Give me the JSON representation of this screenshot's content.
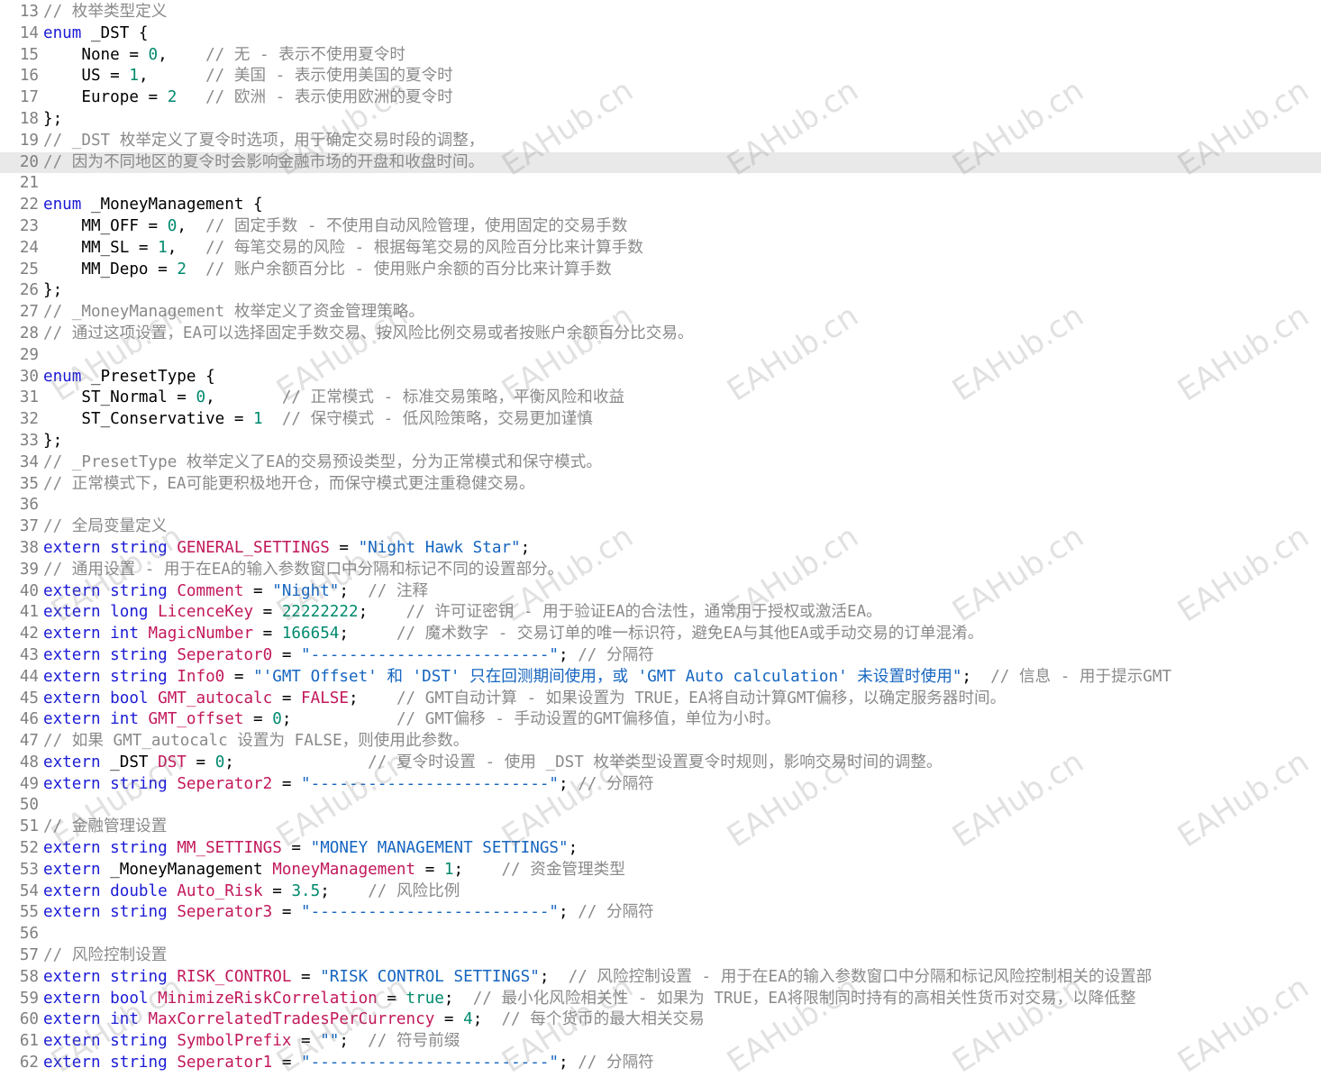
{
  "editor": {
    "lines": [
      {
        "n": "13",
        "t": [
          [
            "c",
            "// 枚举类型定义"
          ]
        ]
      },
      {
        "n": "14",
        "t": [
          [
            "k",
            "enum"
          ],
          [
            "p",
            " _DST {"
          ]
        ]
      },
      {
        "n": "15",
        "t": [
          [
            "i",
            "    None"
          ],
          [
            "p",
            " = "
          ],
          [
            "n",
            "0"
          ],
          [
            "p",
            ",    "
          ],
          [
            "c",
            "// 无 - 表示不使用夏令时"
          ]
        ]
      },
      {
        "n": "16",
        "t": [
          [
            "i",
            "    US"
          ],
          [
            "p",
            " = "
          ],
          [
            "n",
            "1"
          ],
          [
            "p",
            ",      "
          ],
          [
            "c",
            "// 美国 - 表示使用美国的夏令时"
          ]
        ]
      },
      {
        "n": "17",
        "t": [
          [
            "i",
            "    Europe"
          ],
          [
            "p",
            " = "
          ],
          [
            "n",
            "2"
          ],
          [
            "p",
            "   "
          ],
          [
            "c",
            "// 欧洲 - 表示使用欧洲的夏令时"
          ]
        ]
      },
      {
        "n": "18",
        "t": [
          [
            "p",
            "};"
          ]
        ]
      },
      {
        "n": "19",
        "t": [
          [
            "c",
            "// _DST 枚举定义了夏令时选项，用于确定交易时段的调整，"
          ]
        ]
      },
      {
        "n": "20",
        "t": [
          [
            "c",
            "// 因为不同地区的夏令时会影响金融市场的开盘和收盘时间。"
          ]
        ],
        "current": true
      },
      {
        "n": "21",
        "t": []
      },
      {
        "n": "22",
        "t": [
          [
            "k",
            "enum"
          ],
          [
            "p",
            " _MoneyManagement {"
          ]
        ]
      },
      {
        "n": "23",
        "t": [
          [
            "i",
            "    MM_OFF"
          ],
          [
            "p",
            " = "
          ],
          [
            "n",
            "0"
          ],
          [
            "p",
            ",  "
          ],
          [
            "c",
            "// 固定手数 - 不使用自动风险管理，使用固定的交易手数"
          ]
        ]
      },
      {
        "n": "24",
        "t": [
          [
            "i",
            "    MM_SL"
          ],
          [
            "p",
            " = "
          ],
          [
            "n",
            "1"
          ],
          [
            "p",
            ",   "
          ],
          [
            "c",
            "// 每笔交易的风险 - 根据每笔交易的风险百分比来计算手数"
          ]
        ]
      },
      {
        "n": "25",
        "t": [
          [
            "i",
            "    MM_Depo"
          ],
          [
            "p",
            " = "
          ],
          [
            "n",
            "2"
          ],
          [
            "p",
            "  "
          ],
          [
            "c",
            "// 账户余额百分比 - 使用账户余额的百分比来计算手数"
          ]
        ]
      },
      {
        "n": "26",
        "t": [
          [
            "p",
            "};"
          ]
        ]
      },
      {
        "n": "27",
        "t": [
          [
            "c",
            "// _MoneyManagement 枚举定义了资金管理策略。"
          ]
        ]
      },
      {
        "n": "28",
        "t": [
          [
            "c",
            "// 通过这项设置，EA可以选择固定手数交易、按风险比例交易或者按账户余额百分比交易。"
          ]
        ]
      },
      {
        "n": "29",
        "t": []
      },
      {
        "n": "30",
        "t": [
          [
            "k",
            "enum"
          ],
          [
            "p",
            " _PresetType {"
          ]
        ]
      },
      {
        "n": "31",
        "t": [
          [
            "i",
            "    ST_Normal"
          ],
          [
            "p",
            " = "
          ],
          [
            "n",
            "0"
          ],
          [
            "p",
            ",       "
          ],
          [
            "c",
            "// 正常模式 - 标准交易策略，平衡风险和收益"
          ]
        ]
      },
      {
        "n": "32",
        "t": [
          [
            "i",
            "    ST_Conservative"
          ],
          [
            "p",
            " = "
          ],
          [
            "n",
            "1"
          ],
          [
            "p",
            "  "
          ],
          [
            "c",
            "// 保守模式 - 低风险策略，交易更加谨慎"
          ]
        ]
      },
      {
        "n": "33",
        "t": [
          [
            "p",
            "};"
          ]
        ]
      },
      {
        "n": "34",
        "t": [
          [
            "c",
            "// _PresetType 枚举定义了EA的交易预设类型，分为正常模式和保守模式。"
          ]
        ]
      },
      {
        "n": "35",
        "t": [
          [
            "c",
            "// 正常模式下，EA可能更积极地开仓，而保守模式更注重稳健交易。"
          ]
        ]
      },
      {
        "n": "36",
        "t": []
      },
      {
        "n": "37",
        "t": [
          [
            "c",
            "// 全局变量定义"
          ]
        ]
      },
      {
        "n": "38",
        "t": [
          [
            "k",
            "extern"
          ],
          [
            "p",
            " "
          ],
          [
            "k",
            "string"
          ],
          [
            "p",
            " "
          ],
          [
            "v",
            "GENERAL_SETTINGS"
          ],
          [
            "p",
            " = "
          ],
          [
            "s",
            "\"Night Hawk Star\""
          ],
          [
            "p",
            ";"
          ]
        ]
      },
      {
        "n": "39",
        "t": [
          [
            "c",
            "// 通用设置 - 用于在EA的输入参数窗口中分隔和标记不同的设置部分。"
          ]
        ]
      },
      {
        "n": "40",
        "t": [
          [
            "k",
            "extern"
          ],
          [
            "p",
            " "
          ],
          [
            "k",
            "string"
          ],
          [
            "p",
            " "
          ],
          [
            "v",
            "Comment"
          ],
          [
            "p",
            " = "
          ],
          [
            "s",
            "\"Night\""
          ],
          [
            "p",
            ";  "
          ],
          [
            "c",
            "// 注释"
          ]
        ]
      },
      {
        "n": "41",
        "t": [
          [
            "k",
            "extern"
          ],
          [
            "p",
            " "
          ],
          [
            "k",
            "long"
          ],
          [
            "p",
            " "
          ],
          [
            "v",
            "LicenceKey"
          ],
          [
            "p",
            " = "
          ],
          [
            "n",
            "22222222"
          ],
          [
            "p",
            ";    "
          ],
          [
            "c",
            "// 许可证密钥 - 用于验证EA的合法性，通常用于授权或激活EA。"
          ]
        ]
      },
      {
        "n": "42",
        "t": [
          [
            "k",
            "extern"
          ],
          [
            "p",
            " "
          ],
          [
            "k",
            "int"
          ],
          [
            "p",
            " "
          ],
          [
            "v",
            "MagicNumber"
          ],
          [
            "p",
            " = "
          ],
          [
            "n",
            "166654"
          ],
          [
            "p",
            ";     "
          ],
          [
            "c",
            "// 魔术数字 - 交易订单的唯一标识符，避免EA与其他EA或手动交易的订单混淆。"
          ]
        ]
      },
      {
        "n": "43",
        "t": [
          [
            "k",
            "extern"
          ],
          [
            "p",
            " "
          ],
          [
            "k",
            "string"
          ],
          [
            "p",
            " "
          ],
          [
            "v",
            "Seperator0"
          ],
          [
            "p",
            " = "
          ],
          [
            "s",
            "\"-------------------------\""
          ],
          [
            "p",
            "; "
          ],
          [
            "c",
            "// 分隔符"
          ]
        ]
      },
      {
        "n": "44",
        "t": [
          [
            "k",
            "extern"
          ],
          [
            "p",
            " "
          ],
          [
            "k",
            "string"
          ],
          [
            "p",
            " "
          ],
          [
            "v",
            "Info0"
          ],
          [
            "p",
            " = "
          ],
          [
            "s",
            "\"'GMT Offset' 和 'DST' 只在回测期间使用，或 'GMT Auto calculation' 未设置时使用\""
          ],
          [
            "p",
            ";  "
          ],
          [
            "c",
            "// 信息 - 用于提示GMT"
          ]
        ]
      },
      {
        "n": "45",
        "t": [
          [
            "k",
            "extern"
          ],
          [
            "p",
            " "
          ],
          [
            "k",
            "bool"
          ],
          [
            "p",
            " "
          ],
          [
            "v",
            "GMT_autocalc"
          ],
          [
            "p",
            " = "
          ],
          [
            "v",
            "FALSE"
          ],
          [
            "p",
            ";    "
          ],
          [
            "c",
            "// GMT自动计算 - 如果设置为 TRUE，EA将自动计算GMT偏移，以确定服务器时间。"
          ]
        ]
      },
      {
        "n": "46",
        "t": [
          [
            "k",
            "extern"
          ],
          [
            "p",
            " "
          ],
          [
            "k",
            "int"
          ],
          [
            "p",
            " "
          ],
          [
            "v",
            "GMT_offset"
          ],
          [
            "p",
            " = "
          ],
          [
            "n",
            "0"
          ],
          [
            "p",
            ";           "
          ],
          [
            "c",
            "// GMT偏移 - 手动设置的GMT偏移值，单位为小时。"
          ]
        ]
      },
      {
        "n": "47",
        "t": [
          [
            "c",
            "// 如果 GMT_autocalc 设置为 FALSE，则使用此参数。"
          ]
        ]
      },
      {
        "n": "48",
        "t": [
          [
            "k",
            "extern"
          ],
          [
            "p",
            " _DST "
          ],
          [
            "v",
            "DST"
          ],
          [
            "p",
            " = "
          ],
          [
            "n",
            "0"
          ],
          [
            "p",
            ";              "
          ],
          [
            "c",
            "// 夏令时设置 - 使用 _DST 枚举类型设置夏令时规则，影响交易时间的调整。"
          ]
        ]
      },
      {
        "n": "49",
        "t": [
          [
            "k",
            "extern"
          ],
          [
            "p",
            " "
          ],
          [
            "k",
            "string"
          ],
          [
            "p",
            " "
          ],
          [
            "v",
            "Seperator2"
          ],
          [
            "p",
            " = "
          ],
          [
            "s",
            "\"-------------------------\""
          ],
          [
            "p",
            "; "
          ],
          [
            "c",
            "// 分隔符"
          ]
        ]
      },
      {
        "n": "50",
        "t": []
      },
      {
        "n": "51",
        "t": [
          [
            "c",
            "// 金融管理设置"
          ]
        ]
      },
      {
        "n": "52",
        "t": [
          [
            "k",
            "extern"
          ],
          [
            "p",
            " "
          ],
          [
            "k",
            "string"
          ],
          [
            "p",
            " "
          ],
          [
            "v",
            "MM_SETTINGS"
          ],
          [
            "p",
            " = "
          ],
          [
            "s",
            "\"MONEY MANAGEMENT SETTINGS\""
          ],
          [
            "p",
            ";"
          ]
        ]
      },
      {
        "n": "53",
        "t": [
          [
            "k",
            "extern"
          ],
          [
            "p",
            " _MoneyManagement "
          ],
          [
            "v",
            "MoneyManagement"
          ],
          [
            "p",
            " = "
          ],
          [
            "n",
            "1"
          ],
          [
            "p",
            ";    "
          ],
          [
            "c",
            "// 资金管理类型"
          ]
        ]
      },
      {
        "n": "54",
        "t": [
          [
            "k",
            "extern"
          ],
          [
            "p",
            " "
          ],
          [
            "k",
            "double"
          ],
          [
            "p",
            " "
          ],
          [
            "v",
            "Auto_Risk"
          ],
          [
            "p",
            " = "
          ],
          [
            "n",
            "3.5"
          ],
          [
            "p",
            ";    "
          ],
          [
            "c",
            "// 风险比例"
          ]
        ]
      },
      {
        "n": "55",
        "t": [
          [
            "k",
            "extern"
          ],
          [
            "p",
            " "
          ],
          [
            "k",
            "string"
          ],
          [
            "p",
            " "
          ],
          [
            "v",
            "Seperator3"
          ],
          [
            "p",
            " = "
          ],
          [
            "s",
            "\"-------------------------\""
          ],
          [
            "p",
            "; "
          ],
          [
            "c",
            "// 分隔符"
          ]
        ]
      },
      {
        "n": "56",
        "t": []
      },
      {
        "n": "57",
        "t": [
          [
            "c",
            "// 风险控制设置"
          ]
        ]
      },
      {
        "n": "58",
        "t": [
          [
            "k",
            "extern"
          ],
          [
            "p",
            " "
          ],
          [
            "k",
            "string"
          ],
          [
            "p",
            " "
          ],
          [
            "v",
            "RISK_CONTROL"
          ],
          [
            "p",
            " = "
          ],
          [
            "s",
            "\"RISK CONTROL SETTINGS\""
          ],
          [
            "p",
            ";  "
          ],
          [
            "c",
            "// 风险控制设置 - 用于在EA的输入参数窗口中分隔和标记风险控制相关的设置部"
          ]
        ]
      },
      {
        "n": "59",
        "t": [
          [
            "k",
            "extern"
          ],
          [
            "p",
            " "
          ],
          [
            "k",
            "bool"
          ],
          [
            "p",
            " "
          ],
          [
            "v",
            "MinimizeRiskCorrelation"
          ],
          [
            "p",
            " = "
          ],
          [
            "n",
            "true"
          ],
          [
            "p",
            ";  "
          ],
          [
            "c",
            "// 最小化风险相关性 - 如果为 TRUE，EA将限制同时持有的高相关性货币对交易，以降低整"
          ]
        ]
      },
      {
        "n": "60",
        "t": [
          [
            "k",
            "extern"
          ],
          [
            "p",
            " "
          ],
          [
            "k",
            "int"
          ],
          [
            "p",
            " "
          ],
          [
            "v",
            "MaxCorrelatedTradesPerCurrency"
          ],
          [
            "p",
            " = "
          ],
          [
            "n",
            "4"
          ],
          [
            "p",
            ";  "
          ],
          [
            "c",
            "// 每个货币的最大相关交易"
          ]
        ]
      },
      {
        "n": "61",
        "t": [
          [
            "k",
            "extern"
          ],
          [
            "p",
            " "
          ],
          [
            "k",
            "string"
          ],
          [
            "p",
            " "
          ],
          [
            "v",
            "SymbolPrefix"
          ],
          [
            "p",
            " = "
          ],
          [
            "s",
            "\"\""
          ],
          [
            "p",
            ";  "
          ],
          [
            "c",
            "// 符号前缀"
          ]
        ]
      },
      {
        "n": "62",
        "t": [
          [
            "k",
            "extern"
          ],
          [
            "p",
            " "
          ],
          [
            "k",
            "string"
          ],
          [
            "p",
            " "
          ],
          [
            "v",
            "Seperator1"
          ],
          [
            "p",
            " = "
          ],
          [
            "s",
            "\"-------------------------\""
          ],
          [
            "p",
            "; "
          ],
          [
            "c",
            "// 分隔符"
          ]
        ]
      }
    ]
  },
  "watermark": {
    "text": "EAHub.cn"
  }
}
